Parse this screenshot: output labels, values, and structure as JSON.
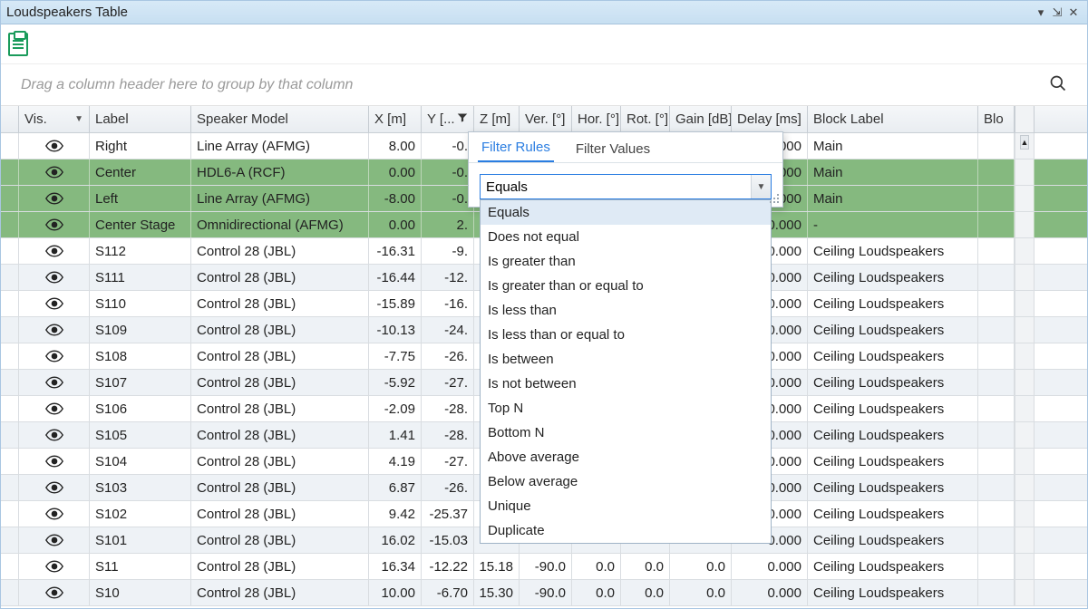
{
  "window": {
    "title": "Loudspeakers Table"
  },
  "group_hint": "Drag a column header here to group by that column",
  "columns": {
    "vis": "Vis.",
    "label": "Label",
    "model": "Speaker Model",
    "x": "X [m]",
    "y": "Y [...",
    "z": "Z [m]",
    "ver": "Ver. [°]",
    "hor": "Hor. [°]",
    "rot": "Rot. [°]",
    "gain": "Gain [dB]",
    "delay": "Delay [ms]",
    "block": "Block Label",
    "blo": "Blo"
  },
  "rows": [
    {
      "sel": false,
      "alt": false,
      "label": "Right",
      "model": "Line Array (AFMG)",
      "x": "8.00",
      "y": "-0.",
      "z": "",
      "ver": "",
      "hor": "",
      "rot": "",
      "gain": "",
      "delay": "0.000",
      "block": "Main"
    },
    {
      "sel": true,
      "alt": false,
      "label": "Center",
      "model": "HDL6-A (RCF)",
      "x": "0.00",
      "y": "-0.",
      "z": "",
      "ver": "",
      "hor": "",
      "rot": "",
      "gain": "",
      "delay": "0.000",
      "block": "Main"
    },
    {
      "sel": true,
      "alt": false,
      "label": "Left",
      "model": "Line Array (AFMG)",
      "x": "-8.00",
      "y": "-0.",
      "z": "",
      "ver": "",
      "hor": "",
      "rot": "",
      "gain": "",
      "delay": "0.000",
      "block": "Main"
    },
    {
      "sel": true,
      "alt": false,
      "label": "Center Stage",
      "model": "Omnidirectional (AFMG)",
      "x": "0.00",
      "y": "2.",
      "z": "",
      "ver": "",
      "hor": "",
      "rot": "",
      "gain": "",
      "delay": "0.000",
      "block": "-"
    },
    {
      "sel": false,
      "alt": false,
      "label": "S112",
      "model": "Control 28 (JBL)",
      "x": "-16.31",
      "y": "-9.",
      "z": "",
      "ver": "",
      "hor": "",
      "rot": "",
      "gain": "",
      "delay": "0.000",
      "block": "Ceiling Loudspeakers"
    },
    {
      "sel": false,
      "alt": true,
      "label": "S111",
      "model": "Control 28 (JBL)",
      "x": "-16.44",
      "y": "-12.",
      "z": "",
      "ver": "",
      "hor": "",
      "rot": "",
      "gain": "",
      "delay": "0.000",
      "block": "Ceiling Loudspeakers"
    },
    {
      "sel": false,
      "alt": false,
      "label": "S110",
      "model": "Control 28 (JBL)",
      "x": "-15.89",
      "y": "-16.",
      "z": "",
      "ver": "",
      "hor": "",
      "rot": "",
      "gain": "",
      "delay": "0.000",
      "block": "Ceiling Loudspeakers"
    },
    {
      "sel": false,
      "alt": true,
      "label": "S109",
      "model": "Control 28 (JBL)",
      "x": "-10.13",
      "y": "-24.",
      "z": "",
      "ver": "",
      "hor": "",
      "rot": "",
      "gain": "",
      "delay": "0.000",
      "block": "Ceiling Loudspeakers"
    },
    {
      "sel": false,
      "alt": false,
      "label": "S108",
      "model": "Control 28 (JBL)",
      "x": "-7.75",
      "y": "-26.",
      "z": "",
      "ver": "",
      "hor": "",
      "rot": "",
      "gain": "",
      "delay": "0.000",
      "block": "Ceiling Loudspeakers"
    },
    {
      "sel": false,
      "alt": true,
      "label": "S107",
      "model": "Control 28 (JBL)",
      "x": "-5.92",
      "y": "-27.",
      "z": "",
      "ver": "",
      "hor": "",
      "rot": "",
      "gain": "",
      "delay": "0.000",
      "block": "Ceiling Loudspeakers"
    },
    {
      "sel": false,
      "alt": false,
      "label": "S106",
      "model": "Control 28 (JBL)",
      "x": "-2.09",
      "y": "-28.",
      "z": "",
      "ver": "",
      "hor": "",
      "rot": "",
      "gain": "",
      "delay": "0.000",
      "block": "Ceiling Loudspeakers"
    },
    {
      "sel": false,
      "alt": true,
      "label": "S105",
      "model": "Control 28 (JBL)",
      "x": "1.41",
      "y": "-28.",
      "z": "",
      "ver": "",
      "hor": "",
      "rot": "",
      "gain": "",
      "delay": "0.000",
      "block": "Ceiling Loudspeakers"
    },
    {
      "sel": false,
      "alt": false,
      "label": "S104",
      "model": "Control 28 (JBL)",
      "x": "4.19",
      "y": "-27.",
      "z": "",
      "ver": "",
      "hor": "",
      "rot": "",
      "gain": "",
      "delay": "0.000",
      "block": "Ceiling Loudspeakers"
    },
    {
      "sel": false,
      "alt": true,
      "label": "S103",
      "model": "Control 28 (JBL)",
      "x": "6.87",
      "y": "-26.",
      "z": "",
      "ver": "",
      "hor": "",
      "rot": "",
      "gain": "",
      "delay": "0.000",
      "block": "Ceiling Loudspeakers"
    },
    {
      "sel": false,
      "alt": false,
      "label": "S102",
      "model": "Control 28 (JBL)",
      "x": "9.42",
      "y": "-25.37",
      "z": "",
      "ver": "",
      "hor": "",
      "rot": "",
      "gain": "",
      "delay": "0.000",
      "block": "Ceiling Loudspeakers"
    },
    {
      "sel": false,
      "alt": true,
      "label": "S101",
      "model": "Control 28 (JBL)",
      "x": "16.02",
      "y": "-15.03",
      "z": "",
      "ver": "",
      "hor": "",
      "rot": "",
      "gain": "",
      "delay": "0.000",
      "block": "Ceiling Loudspeakers"
    },
    {
      "sel": false,
      "alt": false,
      "label": "S11",
      "model": "Control 28 (JBL)",
      "x": "16.34",
      "y": "-12.22",
      "z": "15.18",
      "ver": "-90.0",
      "hor": "0.0",
      "rot": "0.0",
      "gain": "0.0",
      "delay": "0.000",
      "block": "Ceiling Loudspeakers"
    },
    {
      "sel": false,
      "alt": true,
      "label": "S10",
      "model": "Control 28 (JBL)",
      "x": "10.00",
      "y": "-6.70",
      "z": "15.30",
      "ver": "-90.0",
      "hor": "0.0",
      "rot": "0.0",
      "gain": "0.0",
      "delay": "0.000",
      "block": "Ceiling Loudspeakers"
    }
  ],
  "filter": {
    "tabs": {
      "rules": "Filter Rules",
      "values": "Filter Values"
    },
    "selected": "Equals",
    "options": [
      "Equals",
      "Does not equal",
      "Is greater than",
      "Is greater than or equal to",
      "Is less than",
      "Is less than or equal to",
      "Is between",
      "Is not between",
      "Top N",
      "Bottom N",
      "Above average",
      "Below average",
      "Unique",
      "Duplicate"
    ]
  }
}
